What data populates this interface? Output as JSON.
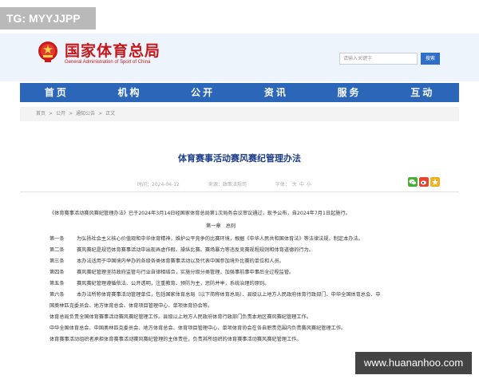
{
  "overlay_tag": "TG: MYYJJPP",
  "header": {
    "site_title": "国家体育总局",
    "site_subtitle": "General Administration of Sport of China",
    "search_placeholder": "请输入关键字",
    "search_button": "搜索"
  },
  "nav": {
    "items": [
      {
        "label": "首页"
      },
      {
        "label": "机构"
      },
      {
        "label": "公开"
      },
      {
        "label": "资讯"
      },
      {
        "label": "服务"
      },
      {
        "label": "互动"
      }
    ]
  },
  "breadcrumb": {
    "items": [
      "首页",
      "公开",
      "通知公告",
      "正文"
    ],
    "separator": ">"
  },
  "article": {
    "title": "体育赛事活动赛风赛纪管理办法",
    "date": "时间：2024-04-12",
    "source": "来源：政策法规司",
    "font_size": "字体：",
    "font_options": [
      "大",
      "中",
      "小"
    ],
    "intro": "《体育赛事活动赛风赛纪管理办法》已于2024年3月14日经国家体育总局第1次局务会议审议通过，现予公布，自2024年7月1日起施行。",
    "chapter": "第一章　总则",
    "articles": [
      {
        "label": "第一条",
        "text": "为弘扬社会主义核心价值观和中华体育精神，维护公平竞争的比赛环境，根据《中华人民共和国体育法》等法律法规，制定本办法。"
      },
      {
        "label": "第二条",
        "text": "赛风赛纪是规范体育赛事活动中出现弄虚作假、操纵比赛、赛场暴力等违反竞赛规程规则和体育道德的行为。"
      },
      {
        "label": "第三条",
        "text": "本办法适用于中国境内举办的各级各类体育赛事活动以及代表中国参加境外比赛的单位和人员。"
      },
      {
        "label": "第四条",
        "text": "赛风赛纪管理坚持政府监管与行业自律相结合，实施分级分类管理，加强事前事中事后全过程监管。"
      },
      {
        "label": "第五条",
        "text": "赛风赛纪管理遵循依法、公开透明，注重教育、预防为主，惩防并举，系统治理的原则。"
      },
      {
        "label": "第六条",
        "text": "本办法所称体育赛事活动管理单位，包括国家体育总局（以下简称体育总局）、县级以上地方人民政府体育行政部门、中华全国体育总会、中"
      }
    ],
    "continuation": [
      "国奥林匹克委员会、地方体育总会、体育项目管理中心、单项体育协会等。",
      "体育总局负责全国体育赛事活动赛风赛纪管理工作。县级以上地方人民政府体育行政部门负责本地区赛风赛纪管理工作。",
      "中华全国体育总会、中国奥林匹克委员会、地方体育总会、体育项目管理中心、单项体育协会在各自职责范围内负责赛风赛纪管理工作。",
      "体育赛事活动组织者承担体育赛事活动赛风赛纪管理的主体责任，负责其所组织的体育赛事活动赛风赛纪管理工作。"
    ]
  },
  "share_icons": [
    {
      "name": "wechat-icon",
      "color": "#46b035"
    },
    {
      "name": "weibo-icon",
      "color": "#e8412f"
    },
    {
      "name": "qzone-icon",
      "color": "#f2b01e"
    }
  ],
  "watermark": "www.huananhoo.com",
  "colors": {
    "brand_red": "#c2181b",
    "nav_blue": "#2b66b8",
    "title_blue": "#1b3c8a"
  }
}
